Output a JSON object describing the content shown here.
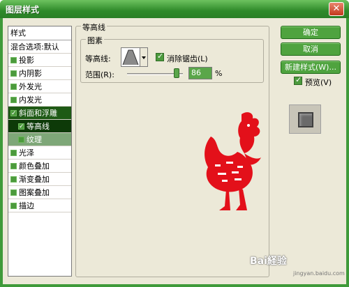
{
  "window": {
    "title": "图层样式"
  },
  "style_list": {
    "header": "样式",
    "blend": "混合选项:默认",
    "items": [
      {
        "label": "投影"
      },
      {
        "label": "内阴影"
      },
      {
        "label": "外发光"
      },
      {
        "label": "内发光"
      },
      {
        "label": "斜面和浮雕"
      },
      {
        "label": "等高线"
      },
      {
        "label": "纹理"
      },
      {
        "label": "光泽"
      },
      {
        "label": "颜色叠加"
      },
      {
        "label": "渐变叠加"
      },
      {
        "label": "图案叠加"
      },
      {
        "label": "描边"
      }
    ]
  },
  "contour_panel": {
    "group_title": "等高线",
    "subgroup_title": "图素",
    "contour_label": "等高线:",
    "antialias_label": "消除锯齿(L)",
    "range_label": "范围(R):",
    "range_value": "86",
    "range_unit": "%"
  },
  "buttons": {
    "ok": "确定",
    "cancel": "取消",
    "new_style": "新建样式(W)...",
    "preview_label": "预览(V)"
  },
  "watermark": {
    "text": "Bai経验",
    "sub": "jingyan.baidu.com"
  },
  "colors": {
    "title_bar": "#3f9a3a",
    "selection": "#1e5a15",
    "rooster": "#e3101a"
  }
}
